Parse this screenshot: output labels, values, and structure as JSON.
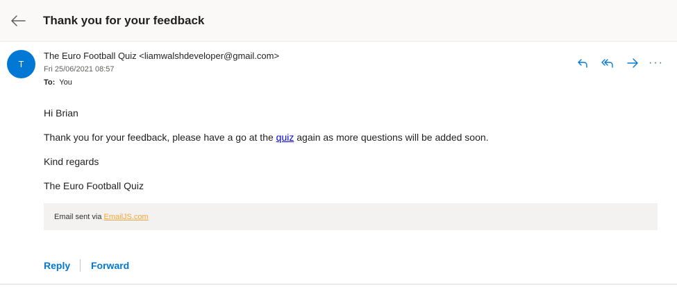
{
  "header": {
    "subject": "Thank you for your feedback"
  },
  "message": {
    "avatar_initial": "T",
    "from": "The Euro Football Quiz <liamwalshdeveloper@gmail.com>",
    "date": "Fri 25/06/2021 08:57",
    "to_label": "To:",
    "to_value": "You"
  },
  "actions": {
    "reply_icon": "reply-icon",
    "reply_all_icon": "reply-all-icon",
    "forward_icon": "forward-icon",
    "more_label": "···"
  },
  "body": {
    "greeting": "Hi Brian",
    "line1_before": "Thank you for your feedback, please have a go at the ",
    "line1_link": "quiz",
    "line1_after": " again as more questions will be added soon.",
    "closing": "Kind regards",
    "signature": "The Euro Football Quiz"
  },
  "sig_box": {
    "prefix": "Email sent via ",
    "link": "EmailJS.com"
  },
  "footer": {
    "reply_label": "Reply",
    "forward_label": "Forward"
  },
  "colors": {
    "accent": "#0078d4",
    "link": "#0000ee",
    "emailjs_link": "#f2a536"
  }
}
